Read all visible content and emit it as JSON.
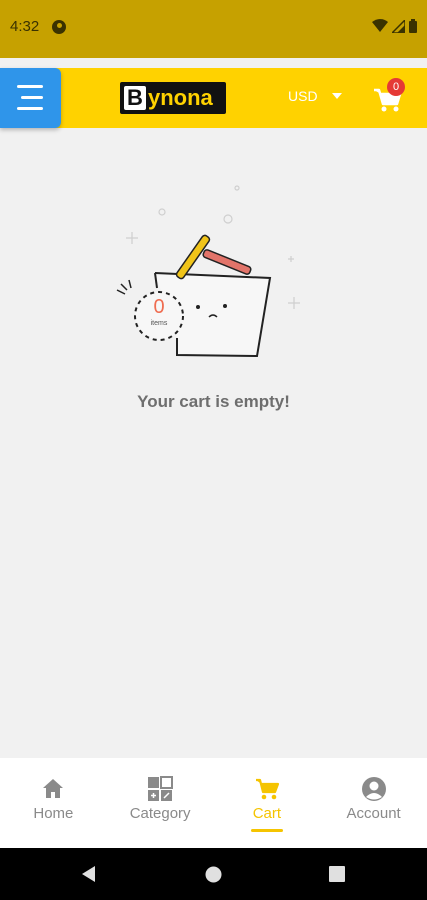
{
  "status_bar": {
    "time": "4:32"
  },
  "app_bar": {
    "logo_letter": "B",
    "logo_rest": "ynona",
    "currency": "USD",
    "cart_count": "0"
  },
  "cart": {
    "items_count": "0",
    "items_label": "items",
    "empty_message": "Your cart is empty!"
  },
  "bottom_nav": {
    "home": "Home",
    "category": "Category",
    "cart": "Cart",
    "account": "Account"
  },
  "colors": {
    "brand_yellow": "#ffd200",
    "menu_blue": "#2f95ea",
    "badge_red": "#e53935",
    "active_yellow": "#f5c400"
  }
}
